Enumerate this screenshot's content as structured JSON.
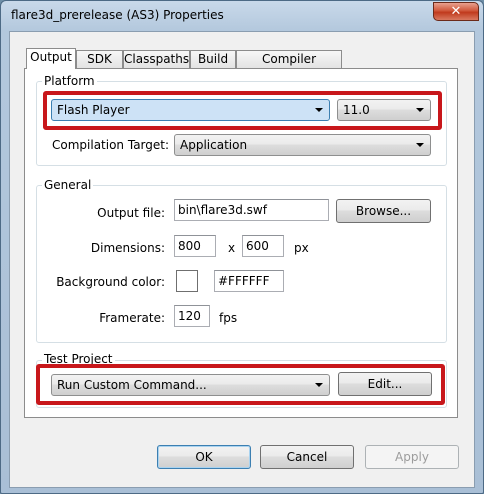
{
  "window": {
    "title": "flare3d_prerelease (AS3) Properties",
    "close_glyph": "✕"
  },
  "tabs": [
    "Output",
    "SDK",
    "Classpaths",
    "Build",
    "Compiler Options"
  ],
  "platform": {
    "group_label": "Platform",
    "player": "Flash Player",
    "version": "11.0",
    "compilation_target_label": "Compilation Target:",
    "compilation_target": "Application"
  },
  "general": {
    "group_label": "General",
    "output_file_label": "Output file:",
    "output_file": "bin\\flare3d.swf",
    "browse_label": "Browse...",
    "dimensions_label": "Dimensions:",
    "width": "800",
    "x_label": "x",
    "height": "600",
    "px_label": "px",
    "bg_color_label": "Background color:",
    "bg_color": "#FFFFFF",
    "framerate_label": "Framerate:",
    "framerate": "120",
    "fps_label": "fps"
  },
  "test_project": {
    "group_label": "Test Project",
    "command": "Run Custom Command...",
    "edit_label": "Edit..."
  },
  "buttons": {
    "ok": "OK",
    "cancel": "Cancel",
    "apply": "Apply"
  },
  "colors": {
    "highlight": "#c8171b",
    "swatch": "#FFFFFF"
  }
}
